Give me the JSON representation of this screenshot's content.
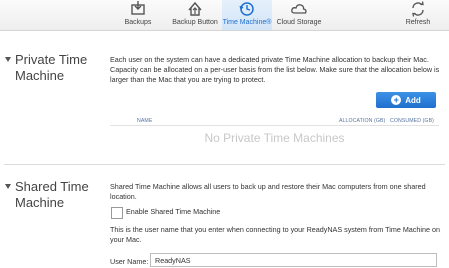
{
  "toolbar": {
    "items": [
      {
        "label": "Backups",
        "icon": "backups-icon"
      },
      {
        "label": "Backup Button",
        "icon": "backup-button-icon"
      },
      {
        "label": "Time Machine®",
        "icon": "time-machine-icon",
        "active": true
      },
      {
        "label": "Cloud Storage",
        "icon": "cloud-storage-icon"
      }
    ],
    "refresh_label": "Refresh"
  },
  "private": {
    "title": "Private Time Machine",
    "description": "Each user on the system can have a dedicated private Time Machine allocation to backup their Mac. Capacity can be allocated on a per-user basis from the list below. Make sure that the allocation below is larger than the Mac that you are trying to protect.",
    "add_label": "Add",
    "columns": [
      "NAME",
      "ALLOCATION (GB)",
      "CONSUMED (GB)"
    ],
    "empty_text": "No Private Time Machines"
  },
  "shared": {
    "title": "Shared Time Machine",
    "description": "Shared Time Machine allows all users to back up and restore their Mac computers from one shared location.",
    "enable_label": "Enable Shared Time Machine",
    "enabled": false,
    "user_info": "This is the user name that you enter when connecting to your ReadyNAS system from Time Machine on your Mac.",
    "user_name_label": "User Name:",
    "user_name_value": "ReadyNAS"
  },
  "colors": {
    "accent": "#1f6fcf",
    "active_tab_bg": "#d8e8f8"
  }
}
